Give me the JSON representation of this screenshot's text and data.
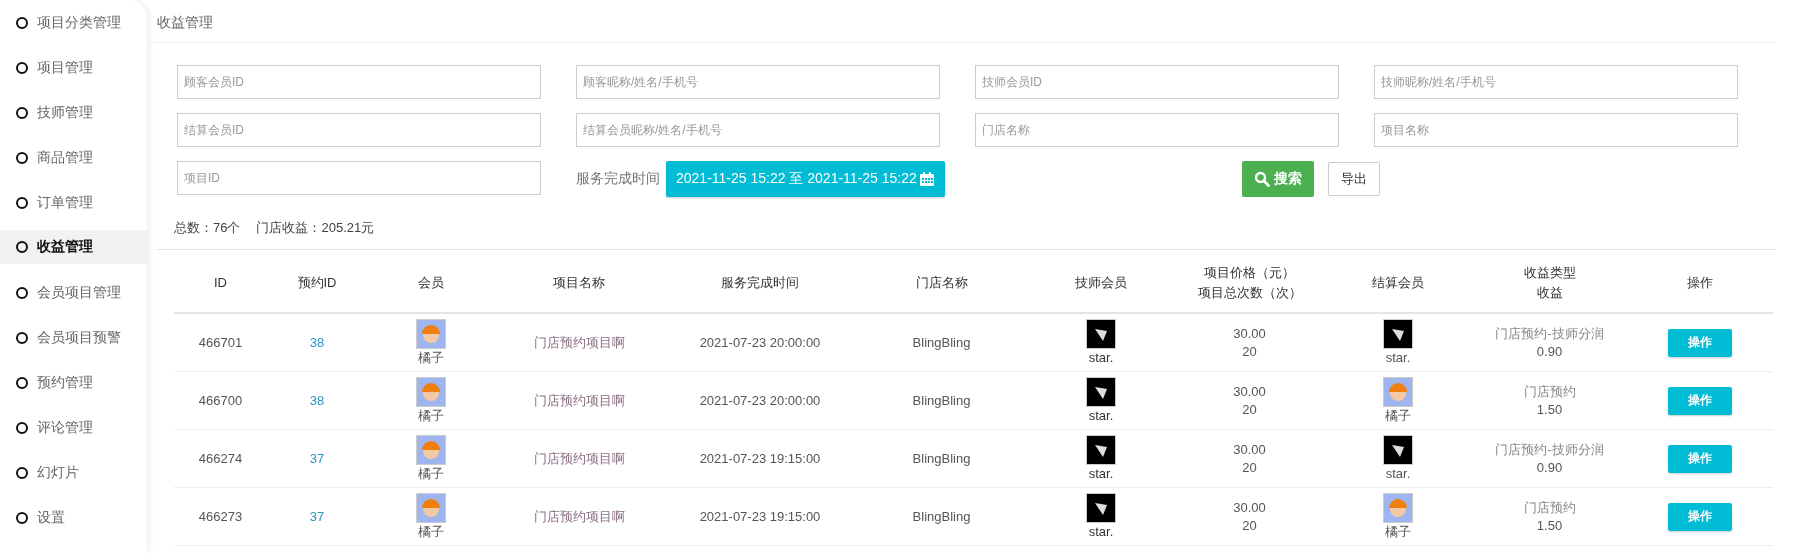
{
  "sidebar": {
    "items": [
      {
        "label": "项目分类管理",
        "selected": false
      },
      {
        "label": "项目管理",
        "selected": false
      },
      {
        "label": "技师管理",
        "selected": false
      },
      {
        "label": "商品管理",
        "selected": false
      },
      {
        "label": "订单管理",
        "selected": false
      },
      {
        "label": "收益管理",
        "selected": true
      },
      {
        "label": "会员项目管理",
        "selected": false
      },
      {
        "label": "会员项目预警",
        "selected": false
      },
      {
        "label": "预约管理",
        "selected": false
      },
      {
        "label": "评论管理",
        "selected": false
      },
      {
        "label": "幻灯片",
        "selected": false
      },
      {
        "label": "设置",
        "selected": false
      }
    ]
  },
  "page_title": "收益管理",
  "filters": [
    {
      "placeholder": "顾客会员ID"
    },
    {
      "placeholder": "顾客昵称/姓名/手机号"
    },
    {
      "placeholder": "技师会员ID"
    },
    {
      "placeholder": "技师昵称/姓名/手机号"
    },
    {
      "placeholder": "结算会员ID"
    },
    {
      "placeholder": "结算会员昵称/姓名/手机号"
    },
    {
      "placeholder": "门店名称"
    },
    {
      "placeholder": "项目名称"
    },
    {
      "placeholder": "项目ID"
    }
  ],
  "date_filter": {
    "label": "服务完成时间",
    "value": "2021-11-25 15:22 至 2021-11-25 15:22"
  },
  "buttons": {
    "search": "搜索",
    "export": "导出"
  },
  "summary": {
    "total_label": "总数：",
    "total": "76个",
    "income_label": "门店收益：",
    "income": "205.21元"
  },
  "table": {
    "columns": [
      [
        "ID"
      ],
      [
        "预约ID"
      ],
      [
        "会员"
      ],
      [
        "项目名称"
      ],
      [
        "服务完成时间"
      ],
      [
        "门店名称"
      ],
      [
        "技师会员"
      ],
      [
        "项目价格（元）",
        "项目总次数（次）"
      ],
      [
        "结算会员"
      ],
      [
        "收益类型",
        "收益"
      ],
      [
        "操作"
      ]
    ],
    "rows": [
      {
        "id": "466701",
        "booking_id": "38",
        "member": {
          "name": "橘子",
          "kind": "girl"
        },
        "project": "门店预约项目啊",
        "time": "2021-07-23 20:00:00",
        "store": "BlingBling",
        "technician": {
          "name": "star.",
          "kind": "dark"
        },
        "price": "30.00",
        "count": "20",
        "settler": {
          "name": "star.",
          "kind": "dark"
        },
        "income_type": "门店预约-技师分润",
        "income": "0.90",
        "action": "操作"
      },
      {
        "id": "466700",
        "booking_id": "38",
        "member": {
          "name": "橘子",
          "kind": "girl"
        },
        "project": "门店预约项目啊",
        "time": "2021-07-23 20:00:00",
        "store": "BlingBling",
        "technician": {
          "name": "star.",
          "kind": "dark"
        },
        "price": "30.00",
        "count": "20",
        "settler": {
          "name": "橘子",
          "kind": "girl"
        },
        "income_type": "门店预约",
        "income": "1.50",
        "action": "操作"
      },
      {
        "id": "466274",
        "booking_id": "37",
        "member": {
          "name": "橘子",
          "kind": "girl"
        },
        "project": "门店预约项目啊",
        "time": "2021-07-23 19:15:00",
        "store": "BlingBling",
        "technician": {
          "name": "star.",
          "kind": "dark"
        },
        "price": "30.00",
        "count": "20",
        "settler": {
          "name": "star.",
          "kind": "dark"
        },
        "income_type": "门店预约-技师分润",
        "income": "0.90",
        "action": "操作"
      },
      {
        "id": "466273",
        "booking_id": "37",
        "member": {
          "name": "橘子",
          "kind": "girl"
        },
        "project": "门店预约项目啊",
        "time": "2021-07-23 19:15:00",
        "store": "BlingBling",
        "technician": {
          "name": "star.",
          "kind": "dark"
        },
        "price": "30.00",
        "count": "20",
        "settler": {
          "name": "橘子",
          "kind": "girl"
        },
        "income_type": "门店预约",
        "income": "1.50",
        "action": "操作"
      }
    ]
  }
}
